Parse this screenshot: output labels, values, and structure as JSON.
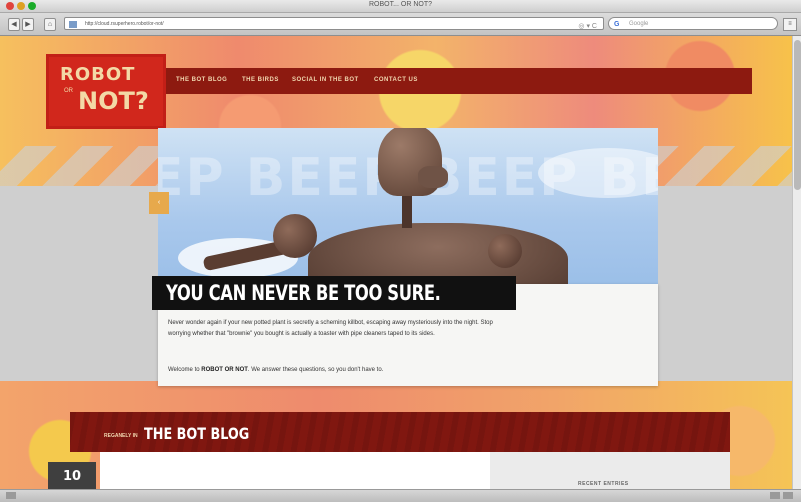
{
  "browser": {
    "window_title": "ROBOT... OR NOT?",
    "url": "http://cloud.rsuperhero.robot/or-not/",
    "search_placeholder": "Google",
    "search_engine_glyph": "G",
    "back_glyph": "◀",
    "forward_glyph": "▶",
    "home_glyph": "⌂",
    "menu_glyph": "≡",
    "rss_glyph": "◎ ▾ C"
  },
  "site": {
    "logo_line1": "ROBOT",
    "logo_or": "OR",
    "logo_line2": "NOT?",
    "nav": [
      "THE BOT BLOG",
      "THE BIRDS",
      "SOCIAL IN THE BOT",
      "CONTACT US"
    ]
  },
  "hero": {
    "background_text": "EP BEEP BEEP BEEP BE",
    "slide_arrow": "‹",
    "caption": "",
    "headline": "YOU CAN NEVER BE TOO SURE."
  },
  "intro": {
    "para1": "Never wonder again if your new potted plant is secretly a scheming killbot, escaping away mysteriously into the night. Stop worrying whether that \"brownie\" you bought is actually a toaster with pipe cleaners taped to its sides.",
    "para2_prefix": "Welcome to ",
    "para2_bold": "ROBOT OR NOT",
    "para2_suffix": ". We answer these questions, so you don't have to."
  },
  "blog": {
    "small_label": "REGANELY IN",
    "title": "THE BOT BLOG",
    "post_date": "10",
    "post_title": "",
    "recent_label": "RECENT ENTRIES"
  },
  "colors": {
    "brand_red": "#d1271c",
    "nav_red": "#8d1a10",
    "headline_black": "#111111",
    "accent_orange": "#e7a94c"
  }
}
